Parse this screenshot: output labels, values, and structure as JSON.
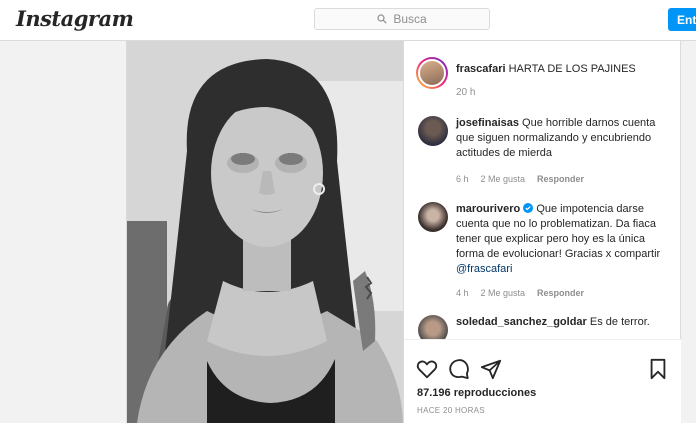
{
  "header": {
    "logo": "Instagram",
    "search_placeholder": "Busca",
    "login_label": "Entrar"
  },
  "post": {
    "author": "frascafari",
    "caption": "HARTA DE LOS PAJINES",
    "time": "20 h",
    "views": "87.196 reproducciones",
    "posted_ago": "HACE 20 HORAS"
  },
  "comments": [
    {
      "user": "josefinaisas",
      "text": "Que horrible darnos cuenta que siguen normalizando y encubriendo actitudes de mierda",
      "time": "6 h",
      "likes": "2 Me gusta",
      "reply": "Responder"
    },
    {
      "user": "marourivero",
      "text": "Que impotencia darse cuenta que no lo problematizan. Da fiaca tener que explicar pero hoy es la única forma de evolucionar! Gracias x compartir",
      "mention": "@frascafari",
      "time": "4 h",
      "likes": "2 Me gusta",
      "reply": "Responder"
    },
    {
      "user": "soledad_sanchez_goldar",
      "text": "Es de terror."
    }
  ],
  "icons": {
    "search": "search-icon",
    "like": "heart-icon",
    "comment": "comment-icon",
    "share": "share-icon",
    "save": "bookmark-icon",
    "verified": "verified-badge-icon"
  },
  "colors": {
    "accent": "#0095f6",
    "mention": "#00376b",
    "muted": "#8e8e8e"
  }
}
